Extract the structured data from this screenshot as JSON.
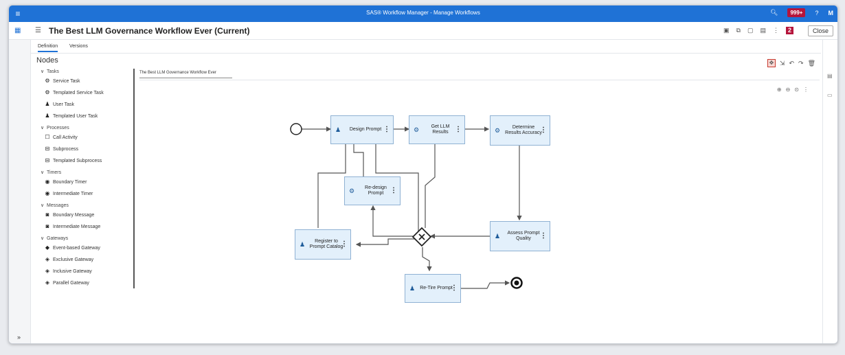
{
  "app": {
    "title": "SAS® Workflow Manager - Manage Workflows",
    "badge": "999+",
    "help": "?",
    "user": "M"
  },
  "toolbar": {
    "workflow_title": "The Best LLM Governance Workflow Ever (Current)",
    "close_label": "Close",
    "notif_count": "2"
  },
  "tabs": [
    {
      "label": "Definition"
    },
    {
      "label": "Versions"
    }
  ],
  "nodes_panel": {
    "title": "Nodes",
    "categories": [
      {
        "label": "Tasks",
        "items": [
          {
            "label": "Service Task",
            "icon": "gear-icon"
          },
          {
            "label": "Templated Service Task",
            "icon": "gear-icon"
          },
          {
            "label": "User Task",
            "icon": "user-icon"
          },
          {
            "label": "Templated User Task",
            "icon": "user-icon"
          }
        ]
      },
      {
        "label": "Processes",
        "items": [
          {
            "label": "Call Activity",
            "icon": "square-icon"
          },
          {
            "label": "Subprocess",
            "icon": "subprocess-icon"
          },
          {
            "label": "Templated Subprocess",
            "icon": "subprocess-icon"
          }
        ]
      },
      {
        "label": "Timers",
        "items": [
          {
            "label": "Boundary Timer",
            "icon": "timer-icon"
          },
          {
            "label": "Intermediate Timer",
            "icon": "timer-icon"
          }
        ]
      },
      {
        "label": "Messages",
        "items": [
          {
            "label": "Boundary Message",
            "icon": "message-icon"
          },
          {
            "label": "Intermediate Message",
            "icon": "message-icon"
          }
        ]
      },
      {
        "label": "Gateways",
        "items": [
          {
            "label": "Event-based Gateway",
            "icon": "diamond-icon"
          },
          {
            "label": "Exclusive Gateway",
            "icon": "diamond-x-icon"
          },
          {
            "label": "Inclusive Gateway",
            "icon": "diamond-o-icon"
          },
          {
            "label": "Parallel Gateway",
            "icon": "diamond-plus-icon"
          }
        ]
      }
    ]
  },
  "canvas": {
    "tab_label": "The Best LLM Governance Workflow Ever"
  },
  "diagram_nodes": {
    "design_prompt": {
      "label": "Design Prompt",
      "icon": "user-icon"
    },
    "get_llm_results": {
      "label": "Get LLM Results",
      "icon": "gear-icon"
    },
    "determine_accuracy": {
      "label": "Determine Results Accuracy",
      "icon": "gear-icon"
    },
    "redesign_prompt": {
      "label": "Re-design Prompt",
      "icon": "gear-icon"
    },
    "register_catalog": {
      "label": "Register to Prompt Catalog",
      "icon": "user-icon"
    },
    "assess_quality": {
      "label": "Assess Prompt Quality",
      "icon": "user-icon"
    },
    "retire_prompt": {
      "label": "Re-Tire Prompt",
      "icon": "user-icon"
    }
  },
  "colors": {
    "accent": "#1f72d6",
    "node_fill": "#e3f0fb",
    "node_border": "#8fb1d3",
    "badge": "#b5153c"
  }
}
